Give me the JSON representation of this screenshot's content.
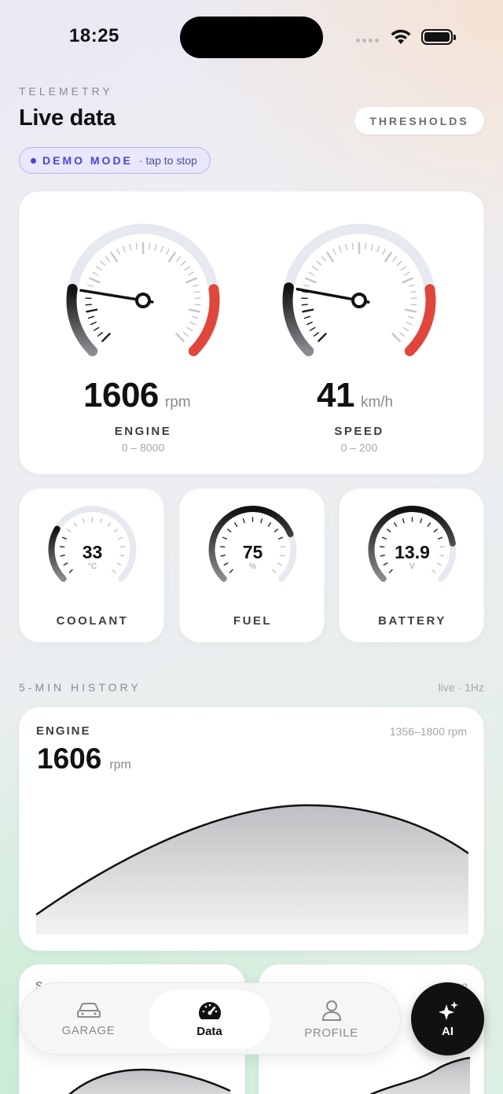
{
  "status_bar": {
    "time": "18:25"
  },
  "header": {
    "eyebrow": "TELEMETRY",
    "title": "Live data",
    "thresholds_label": "THRESHOLDS",
    "demo_label": "DEMO MODE",
    "demo_hint": "· tap to stop"
  },
  "gauges": {
    "engine": {
      "value": "1606",
      "unit": "rpm",
      "label": "ENGINE",
      "range": "0 – 8000",
      "min": 0,
      "max": 8000,
      "reading": 1606
    },
    "speed": {
      "value": "41",
      "unit": "km/h",
      "label": "SPEED",
      "range": "0 – 200",
      "min": 0,
      "max": 200,
      "reading": 41
    }
  },
  "small_gauges": [
    {
      "value": "33",
      "unit": "°C",
      "label": "COOLANT",
      "fraction": 0.28
    },
    {
      "value": "75",
      "unit": "%",
      "label": "FUEL",
      "fraction": 0.75
    },
    {
      "value": "13.9",
      "unit": "V",
      "label": "BATTERY",
      "fraction": 0.8
    }
  ],
  "history": {
    "title": "5-MIN HISTORY",
    "rate": "live · 1Hz",
    "engine": {
      "label": "ENGINE",
      "range": "1356–1800 rpm",
      "value": "1606",
      "unit": "rpm"
    },
    "mini_left": {
      "label": "S"
    },
    "mini_right": {
      "range": "22"
    }
  },
  "tabs": [
    {
      "label": "GARAGE",
      "icon": "car-icon"
    },
    {
      "label": "Data",
      "icon": "speedometer-icon"
    },
    {
      "label": "PROFILE",
      "icon": "person-icon"
    }
  ],
  "ai_button": {
    "label": "AI",
    "icon": "sparkles-icon"
  },
  "colors": {
    "accent": "#4b43d6",
    "redzone": "#e0463c",
    "track": "#e6e9ef"
  }
}
